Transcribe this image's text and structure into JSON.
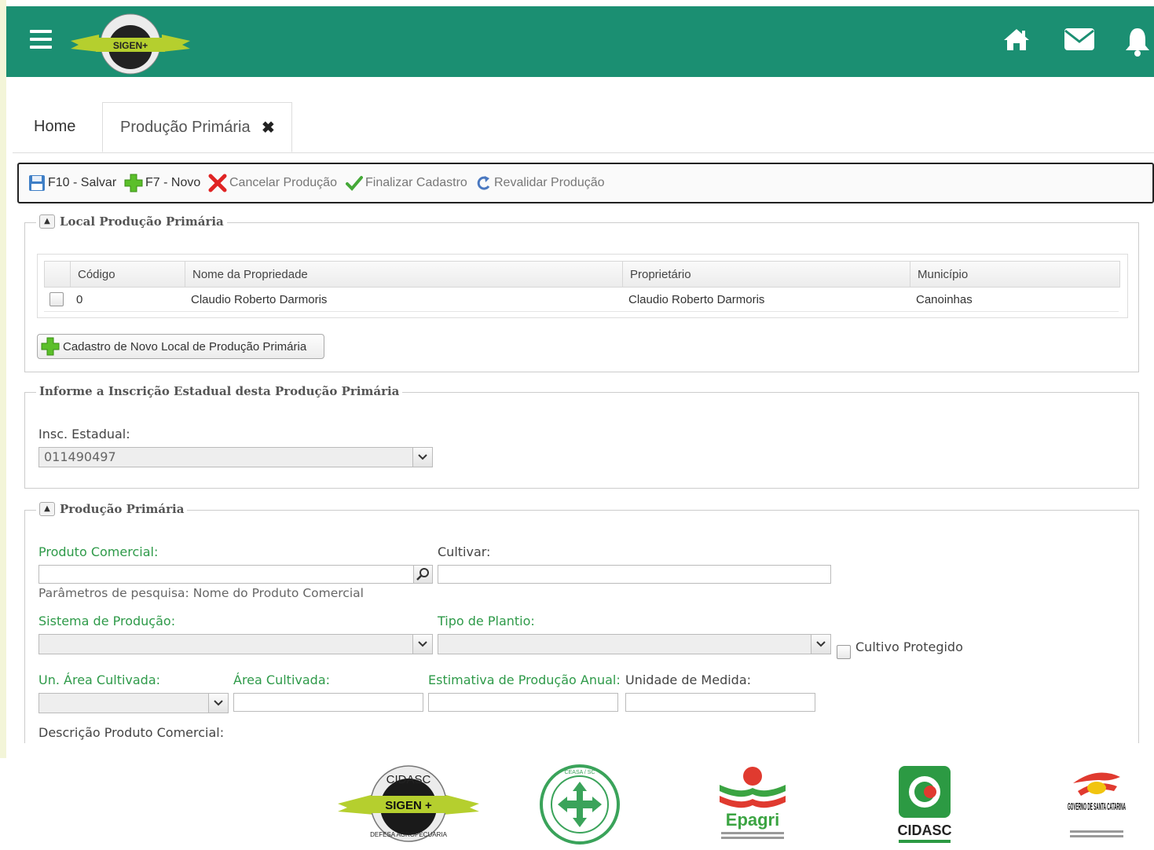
{
  "header": {
    "logo_name": "SIGEN+",
    "brand_color": "#1b8f72",
    "icons": [
      "menu-icon",
      "home-icon",
      "mail-icon",
      "bell-icon"
    ]
  },
  "tabs": {
    "home_label": "Home",
    "active_label": "Produção Primária"
  },
  "toolbar": {
    "save_label": "F10 - Salvar",
    "new_label": "F7 - Novo",
    "cancel_label": "Cancelar Produção",
    "finalize_label": "Finalizar Cadastro",
    "revalidate_label": "Revalidar Produção"
  },
  "local_section": {
    "title": "Local Produção Primária",
    "columns": [
      "Código",
      "Nome da Propriedade",
      "Proprietário",
      "Município"
    ],
    "rows": [
      {
        "codigo": "0",
        "nome": "Claudio Roberto Darmoris",
        "proprietario": "Claudio Roberto Darmoris",
        "municipio": "Canoinhas"
      }
    ],
    "new_local_button": "Cadastro de Novo Local de Produção Primária"
  },
  "inscricao_section": {
    "title": "Informe a Inscrição Estadual desta Produção Primária",
    "label": "Insc. Estadual:",
    "value": "011490497"
  },
  "producao_section": {
    "title": "Produção Primária",
    "produto_label": "Produto Comercial:",
    "produto_value": "",
    "search_hint": "Parâmetros de pesquisa: Nome do Produto Comercial",
    "cultivar_label": "Cultivar:",
    "cultivar_value": "",
    "sistema_label": "Sistema de Produção:",
    "sistema_value": "",
    "tipo_label": "Tipo de Plantio:",
    "tipo_value": "",
    "cultivo_label": "Cultivo Protegido",
    "un_area_label": "Un. Área Cultivada:",
    "un_area_value": "",
    "area_label": "Área Cultivada:",
    "area_value": "",
    "estimativa_label": "Estimativa de Produção Anual:",
    "estimativa_value": "",
    "unidade_label": "Unidade de Medida:",
    "unidade_value": "",
    "descricao_label": "Descrição Produto Comercial:"
  },
  "footer": {
    "logos": [
      "CIDASC",
      "SIGEN +",
      "DEFESA AGROPECUÁRIA",
      "CEASA / SC",
      "Epagri",
      "CIDASC",
      "GOVERNO DE SANTA CATARINA"
    ]
  }
}
